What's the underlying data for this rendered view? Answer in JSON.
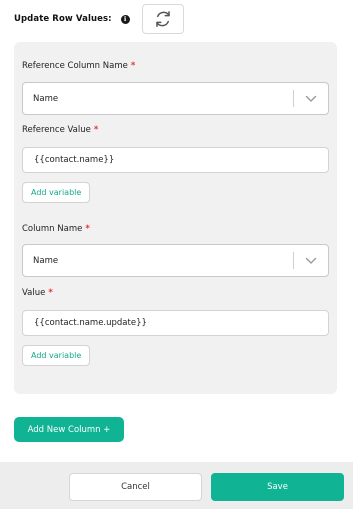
{
  "header": {
    "title": "Update Row Values:",
    "info_icon": "info-icon",
    "refresh_icon": "refresh-icon"
  },
  "panel": {
    "reference_column": {
      "label": "Reference Column Name",
      "required_marker": "*",
      "selected": "Name"
    },
    "reference_value": {
      "label": "Reference Value",
      "required_marker": "*",
      "value": "{{contact.name}}",
      "add_variable_label": "Add variable"
    },
    "column": {
      "label": "Column Name",
      "required_marker": "*",
      "selected": "Name"
    },
    "value": {
      "label": "Value",
      "required_marker": "*",
      "value": "{{contact.name.update}}",
      "add_variable_label": "Add variable"
    }
  },
  "add_new_column_label": "Add New Column +",
  "footer": {
    "cancel_label": "Cancel",
    "save_label": "Save"
  },
  "colors": {
    "accent": "#10b394",
    "required": "#e3342f",
    "panel_bg": "#f1f1f1"
  }
}
